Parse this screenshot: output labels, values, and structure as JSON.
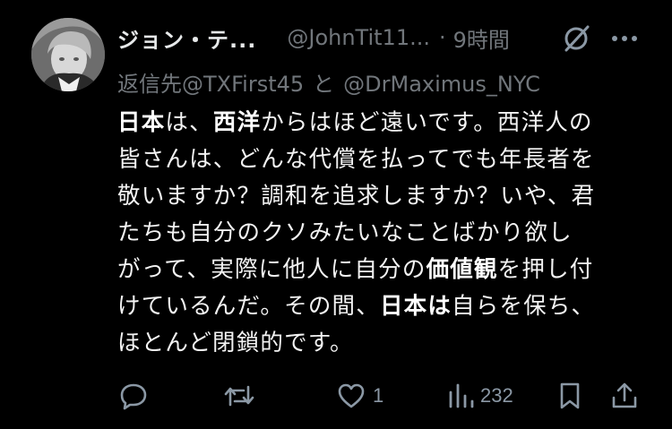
{
  "tweet": {
    "display_name": "ジョン・テ...",
    "handle": "@JohnTit11...",
    "separator": "·",
    "time": "9時間",
    "reply_prefix": "返信先",
    "reply_mention_1": "@TXFirst45",
    "reply_conjunction": "と",
    "reply_mention_2": "@DrMaximus_NYC",
    "body": {
      "l1_b1": "日本",
      "l1_t1": "は、",
      "l1_b2": "西洋",
      "l1_t2": "からはほど遠いです。西洋人の",
      "l2": "皆さんは、どんな代償を払ってでも年長者を",
      "l3": "敬いますか？調和を追求しますか？いや、君",
      "l4": "たちも自分のクソみたいなことばかり欲し",
      "l5_t1": "がって、実際に他人に自分の",
      "l5_b1": "価値観",
      "l5_t2": "を押し付",
      "l6_t1": "けているんだ。その間、",
      "l6_b1": "日本は",
      "l6_t2": "自ら",
      "l6_t3": "を保ち、",
      "l7": "ほとんど閉鎖的です。"
    },
    "actions": {
      "reply_count": "",
      "retweet_count": "",
      "like_count": "1",
      "views_count": "232"
    }
  },
  "icons": {
    "avatar": "avatar-anime-character",
    "grok": "grok-slash-icon",
    "more": "more-horizontal-icon",
    "reply": "reply-bubble-icon",
    "retweet": "retweet-icon",
    "like": "heart-icon",
    "views": "views-bar-chart-icon",
    "bookmark": "bookmark-icon",
    "share": "share-upload-icon"
  },
  "colors": {
    "background": "#000000",
    "primary_text": "#e7e9ea",
    "secondary_text": "#71767b",
    "icon": "#8b98a5"
  }
}
